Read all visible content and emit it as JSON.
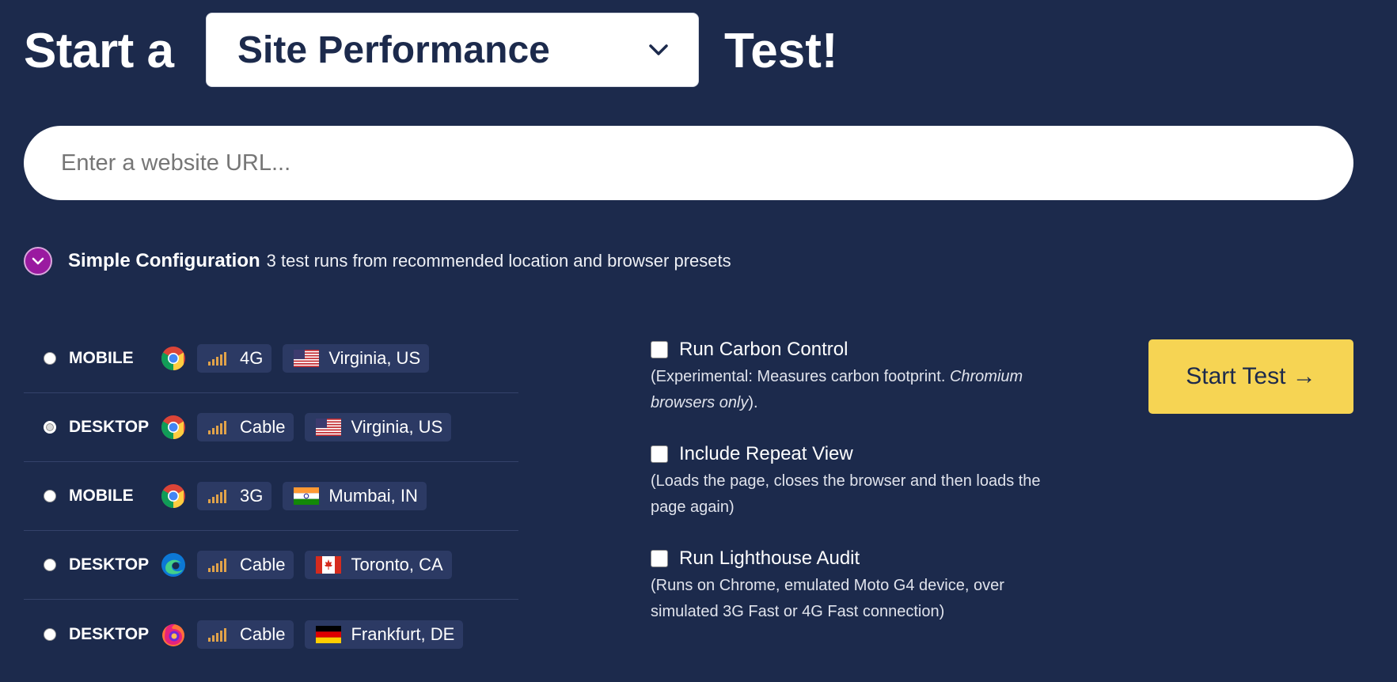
{
  "header": {
    "prefix": "Start a",
    "test_type": "Site Performance",
    "suffix": "Test!"
  },
  "url_input": {
    "placeholder": "Enter a website URL...",
    "value": ""
  },
  "config": {
    "title": "Simple Configuration",
    "description": "3 test runs from recommended location and browser presets"
  },
  "presets": [
    {
      "device": "MOBILE",
      "browser": "chrome-icon",
      "connection": "4G",
      "location": "Virginia, US",
      "flag": "us-flag-icon",
      "selected": false
    },
    {
      "device": "DESKTOP",
      "browser": "chrome-icon",
      "connection": "Cable",
      "location": "Virginia, US",
      "flag": "us-flag-icon",
      "selected": true
    },
    {
      "device": "MOBILE",
      "browser": "chrome-icon",
      "connection": "3G",
      "location": "Mumbai, IN",
      "flag": "in-flag-icon",
      "selected": false
    },
    {
      "device": "DESKTOP",
      "browser": "edge-icon",
      "connection": "Cable",
      "location": "Toronto, CA",
      "flag": "ca-flag-icon",
      "selected": false
    },
    {
      "device": "DESKTOP",
      "browser": "firefox-icon",
      "connection": "Cable",
      "location": "Frankfurt, DE",
      "flag": "de-flag-icon",
      "selected": false
    }
  ],
  "options": {
    "carbon": {
      "label": "Run Carbon Control",
      "note_prefix": "(Experimental: Measures carbon footprint. ",
      "note_italic": "Chromium browsers only",
      "note_suffix": ").",
      "checked": false
    },
    "repeat": {
      "label": "Include Repeat View",
      "note": "(Loads the page, closes the browser and then loads the page again)",
      "checked": false
    },
    "lighthouse": {
      "label": "Run Lighthouse Audit",
      "note": "(Runs on Chrome, emulated Moto G4 device, over simulated 3G Fast or 4G Fast connection)",
      "checked": false
    }
  },
  "start_button": {
    "label": "Start Test →"
  },
  "colors": {
    "background": "#1c2a4c",
    "accent_button": "#f6d453",
    "toggle": "#9a1aa0",
    "signal": "#e0a24a",
    "pill": "#2c3a64"
  }
}
